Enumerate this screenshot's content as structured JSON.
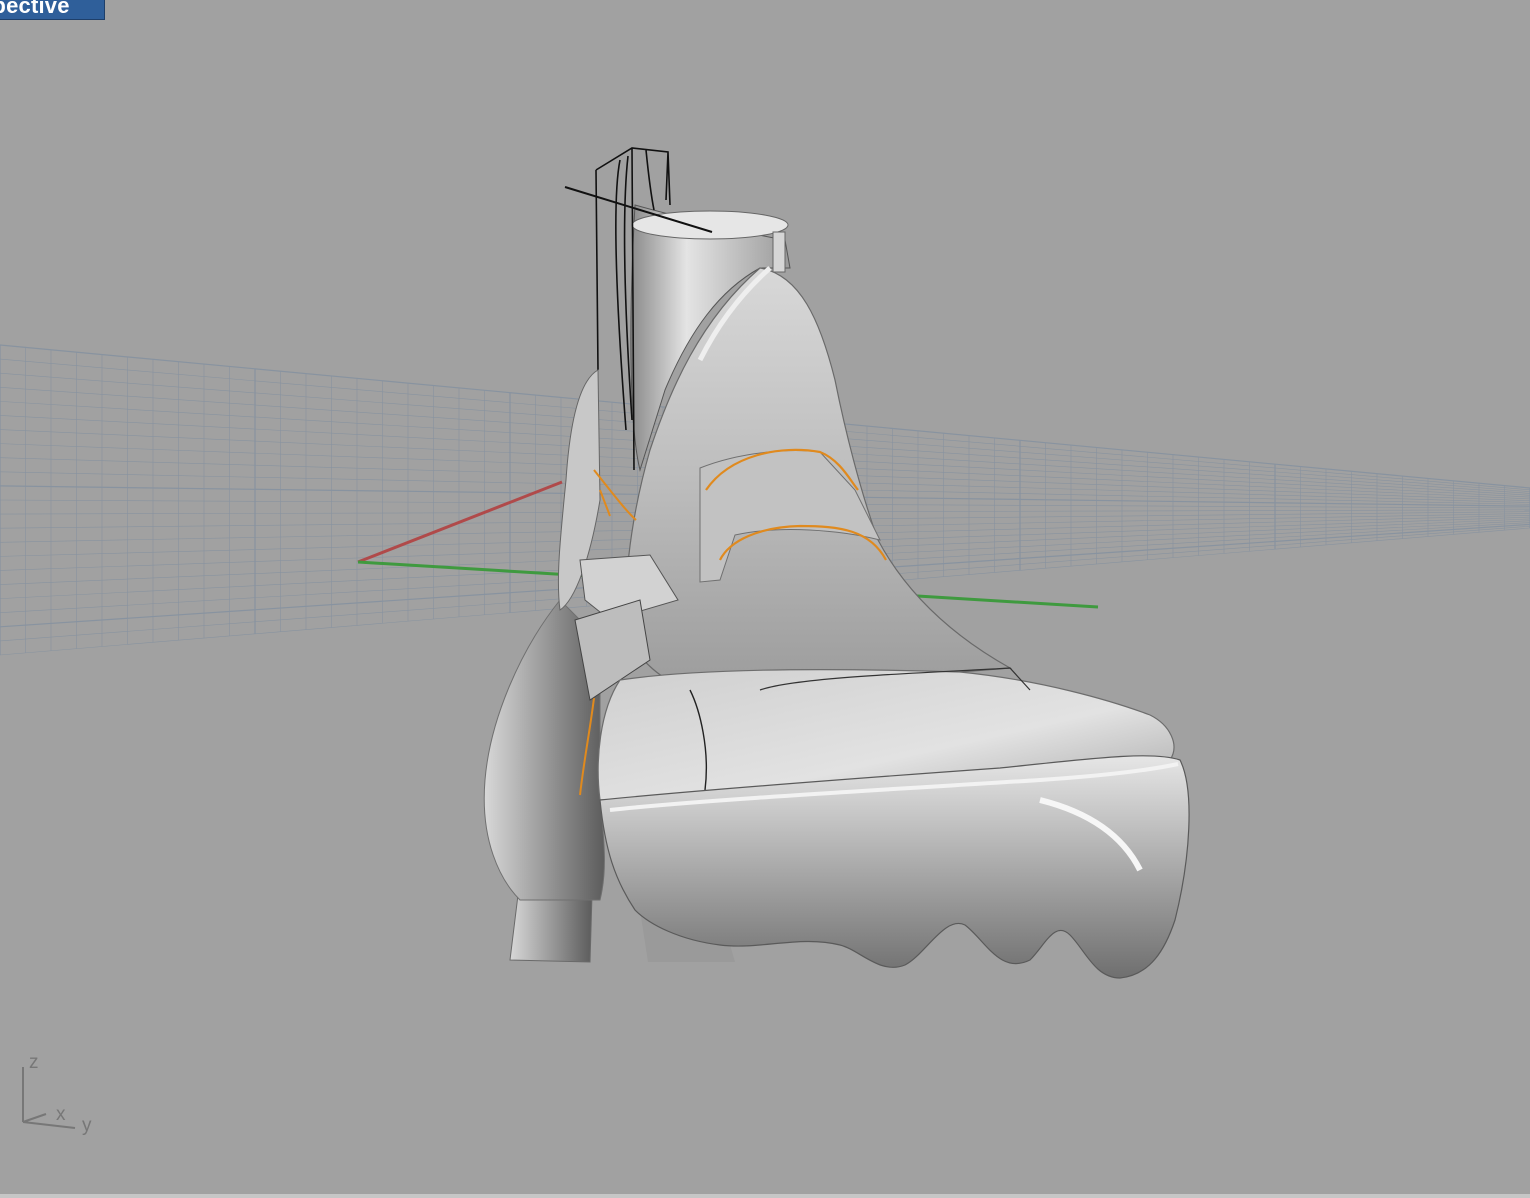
{
  "viewport": {
    "title": "Perspective",
    "title_visible": "spective",
    "background_color": "#a1a1a1",
    "tab_color": "#2f5f9a"
  },
  "grid": {
    "color": "#8893a0",
    "x_axis_color": "#b04a4a",
    "y_axis_color": "#3f9a3f"
  },
  "axis_indicator": {
    "z_label": "z",
    "x_label": "x",
    "y_label": "y"
  },
  "model": {
    "description_icon": "boot-model",
    "curve_color": "#e08a1e",
    "surface_color": "#c8c8c8"
  }
}
